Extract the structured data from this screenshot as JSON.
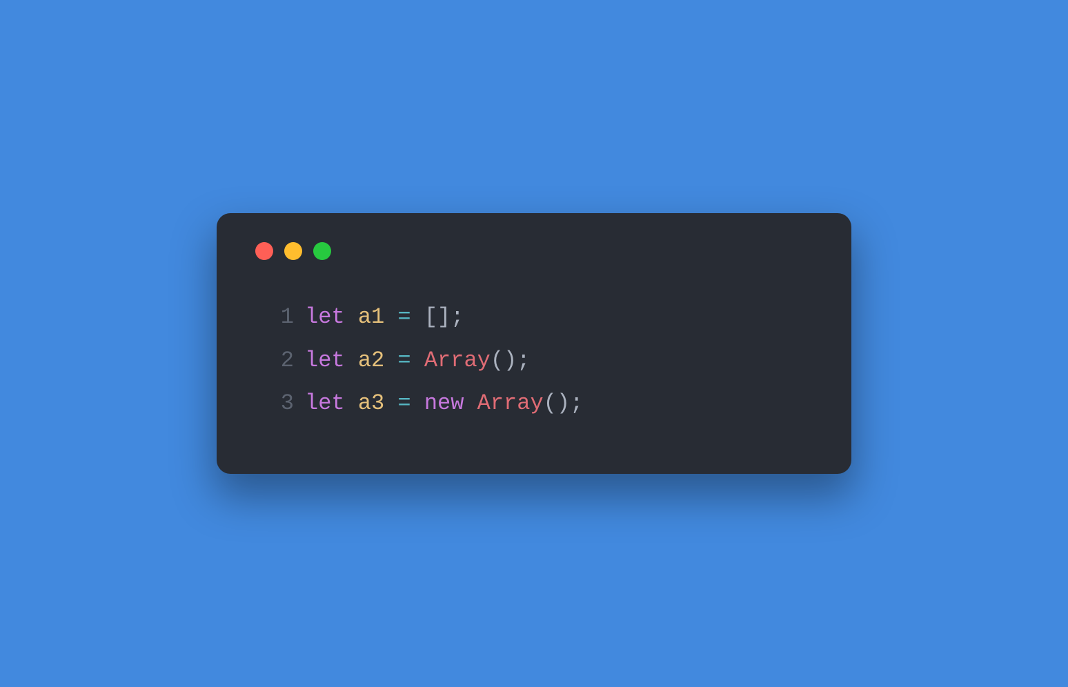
{
  "window": {
    "controls": {
      "close_color": "#ff5f56",
      "minimize_color": "#ffbd2e",
      "zoom_color": "#27c93f"
    }
  },
  "code": {
    "lines": [
      {
        "number": "1",
        "tokens": [
          {
            "text": "let",
            "cls": "tok-keyword"
          },
          {
            "text": " ",
            "cls": "tok-space"
          },
          {
            "text": "a1",
            "cls": "tok-ident"
          },
          {
            "text": " ",
            "cls": "tok-space"
          },
          {
            "text": "=",
            "cls": "tok-operator"
          },
          {
            "text": " ",
            "cls": "tok-space"
          },
          {
            "text": "[];",
            "cls": "tok-punct"
          }
        ]
      },
      {
        "number": "2",
        "tokens": [
          {
            "text": "let",
            "cls": "tok-keyword"
          },
          {
            "text": " ",
            "cls": "tok-space"
          },
          {
            "text": "a2",
            "cls": "tok-ident"
          },
          {
            "text": " ",
            "cls": "tok-space"
          },
          {
            "text": "=",
            "cls": "tok-operator"
          },
          {
            "text": " ",
            "cls": "tok-space"
          },
          {
            "text": "Array",
            "cls": "tok-class"
          },
          {
            "text": "();",
            "cls": "tok-punct"
          }
        ]
      },
      {
        "number": "3",
        "tokens": [
          {
            "text": "let",
            "cls": "tok-keyword"
          },
          {
            "text": " ",
            "cls": "tok-space"
          },
          {
            "text": "a3",
            "cls": "tok-ident"
          },
          {
            "text": " ",
            "cls": "tok-space"
          },
          {
            "text": "=",
            "cls": "tok-operator"
          },
          {
            "text": " ",
            "cls": "tok-space"
          },
          {
            "text": "new",
            "cls": "tok-keyword"
          },
          {
            "text": " ",
            "cls": "tok-space"
          },
          {
            "text": "Array",
            "cls": "tok-class"
          },
          {
            "text": "();",
            "cls": "tok-punct"
          }
        ]
      }
    ]
  }
}
